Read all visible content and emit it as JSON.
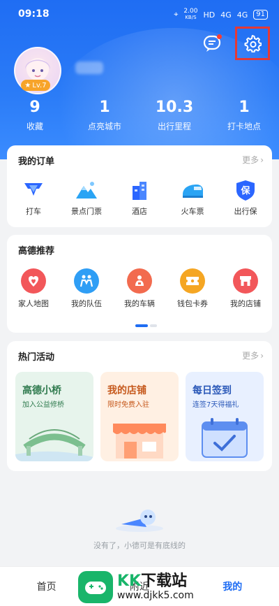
{
  "status": {
    "time": "09:18",
    "net_speed": "2.00",
    "net_unit": "KB/S",
    "hd": "HD",
    "net1": "4G",
    "net2": "4G",
    "battery": "91"
  },
  "profile": {
    "level": "Lv.7"
  },
  "stats": [
    {
      "value": "9",
      "label": "收藏"
    },
    {
      "value": "1",
      "label": "点亮城市"
    },
    {
      "value": "10.3",
      "label": "出行里程"
    },
    {
      "value": "1",
      "label": "打卡地点"
    }
  ],
  "orders": {
    "title": "我的订单",
    "more": "更多",
    "items": [
      {
        "label": "打车",
        "color": "#2b66ff",
        "icon": "taxi-icon"
      },
      {
        "label": "景点门票",
        "color": "#2aa4f4",
        "icon": "mountain-icon"
      },
      {
        "label": "酒店",
        "color": "#2b66ff",
        "icon": "hotel-icon"
      },
      {
        "label": "火车票",
        "color": "#2aa4f4",
        "icon": "train-icon"
      },
      {
        "label": "出行保",
        "color": "#2b66ff",
        "icon": "shield-icon"
      }
    ]
  },
  "recommend": {
    "title": "高德推荐",
    "items": [
      {
        "label": "家人地图",
        "color": "#f2575a",
        "icon": "heart-pin-icon"
      },
      {
        "label": "我的队伍",
        "color": "#2f9ef5",
        "icon": "team-icon"
      },
      {
        "label": "我的车辆",
        "color": "#f26b4f",
        "icon": "car-icon"
      },
      {
        "label": "钱包卡券",
        "color": "#f5a623",
        "icon": "ticket-icon"
      },
      {
        "label": "我的店铺",
        "color": "#f2575a",
        "icon": "store-icon"
      }
    ]
  },
  "activities": {
    "title": "热门活动",
    "more": "更多",
    "cards": [
      {
        "title": "高德小桥",
        "subtitle": "加入公益修桥",
        "bg": "#e7f4ec",
        "fg": "#2f7a4e"
      },
      {
        "title": "我的店铺",
        "subtitle": "限时免费入驻",
        "bg": "#fff0e3",
        "fg": "#c65a1e"
      },
      {
        "title": "每日签到",
        "subtitle": "连签7天得福礼",
        "bg": "#e8f0ff",
        "fg": "#2a58b8"
      }
    ]
  },
  "empty_text": "没有了，小德可是有底线的",
  "tabs": [
    {
      "label": "首页"
    },
    {
      "label": "附近"
    },
    {
      "label": "我的"
    }
  ],
  "watermark": {
    "kk": "KK",
    "rest": "下载站",
    "url": "www.djkk5.com"
  }
}
